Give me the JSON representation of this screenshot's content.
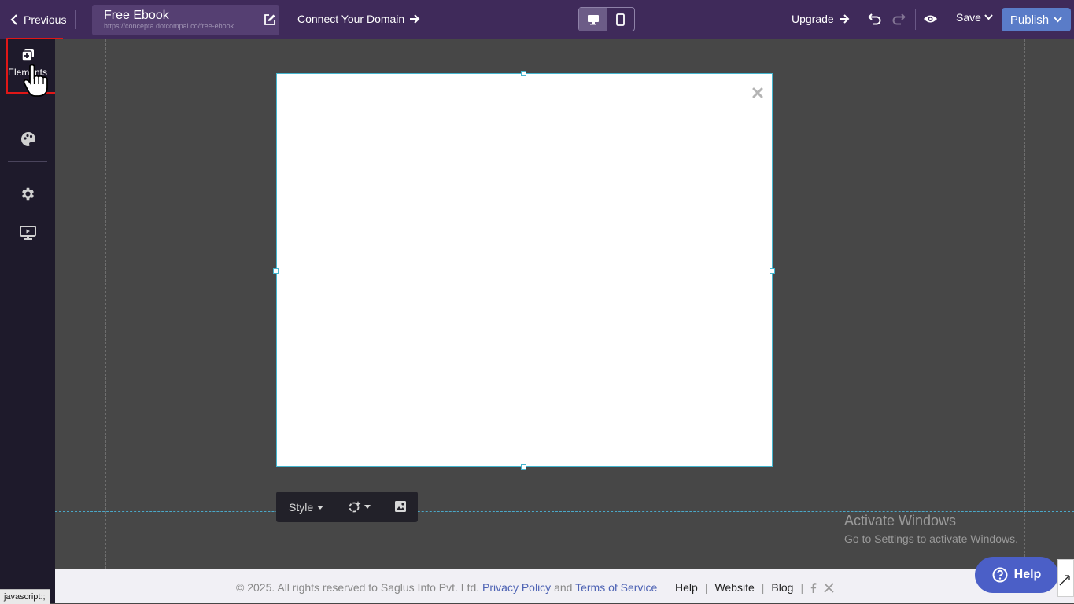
{
  "topbar": {
    "previous_label": "Previous",
    "page_title": "Free Ebook",
    "page_url": "https://concepta.dotcompal.co/free-ebook",
    "connect_domain_label": "Connect Your Domain",
    "device_options": [
      "desktop-icon",
      "mobile-icon"
    ],
    "active_device": "desktop",
    "upgrade_label": "Upgrade",
    "save_label": "Save",
    "publish_label": "Publish"
  },
  "sidebar": {
    "items": [
      {
        "label": "Elements",
        "icon": "elements-icon"
      },
      {
        "label": "",
        "icon": "palette-icon"
      },
      {
        "label": "",
        "icon": "gear-icon"
      },
      {
        "label": "",
        "icon": "monitor-icon"
      }
    ]
  },
  "canvas": {
    "popup_close_icon": "close-icon",
    "toolbar": {
      "style_label": "Style",
      "icons": [
        "effects-icon",
        "image-icon"
      ]
    }
  },
  "watermark": {
    "title": "Activate Windows",
    "subtitle": "Go to Settings to activate Windows."
  },
  "footer": {
    "copyright": "©  2025. All rights reserved to Saglus Info Pvt. Ltd.",
    "privacy_label": "Privacy Policy",
    "and_text": "and",
    "terms_label": "Terms of Service",
    "links": [
      "Help",
      "Website",
      "Blog"
    ],
    "separator": "|",
    "social_icons": [
      "facebook-icon",
      "x-icon"
    ]
  },
  "help_button_label": "Help",
  "status_bar_text": "javascript:;",
  "colors": {
    "topbar": "#3f2a5a",
    "sidebar": "#1e1a2b",
    "canvas": "#474747",
    "publish": "#5a7cc8",
    "help": "#4b5fc7",
    "highlight": "#e01717",
    "selection": "#45b6cf"
  }
}
